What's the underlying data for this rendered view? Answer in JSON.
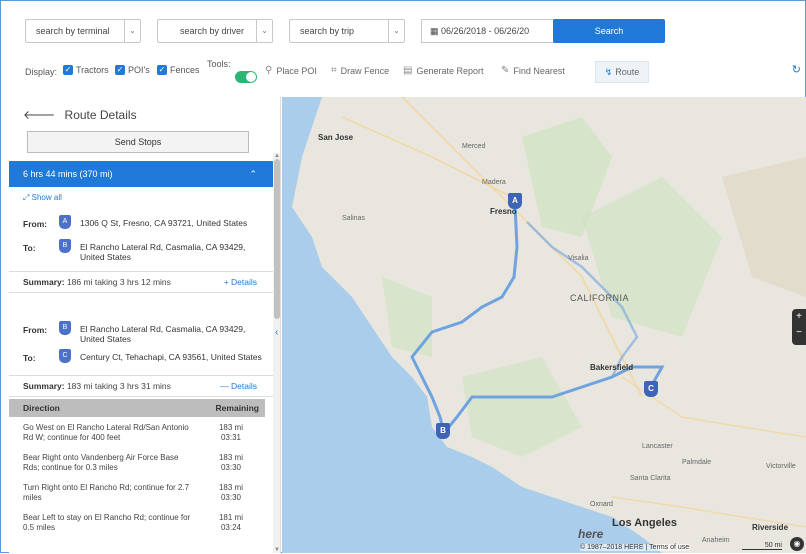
{
  "search": {
    "terminal": "search by terminal",
    "driver": "search by driver",
    "trip": "search by trip",
    "date_range": "06/26/2018 - 06/26/20",
    "button": "Search"
  },
  "display": {
    "label": "Display:",
    "checks": [
      "Tractors",
      "POI's",
      "Fences"
    ],
    "tools_label": "Tools:",
    "tools": [
      "Place POI",
      "Draw Fence",
      "Generate Report",
      "Find Nearest"
    ],
    "route": "Route"
  },
  "panel": {
    "title": "Route Details",
    "send_stops": "Send Stops",
    "route_summary": "6 hrs 44 mins (370 mi)",
    "show_all": "Show all",
    "legs": [
      {
        "from_label": "From:",
        "from_pin": "A",
        "from": "1306 Q St, Fresno, CA 93721, United States",
        "to_label": "To:",
        "to_pin": "B",
        "to": "El Rancho Lateral Rd, Casmalia, CA 93429, United States",
        "summary_label": "Summary:",
        "summary": "186 mi taking 3 hrs 12 mins",
        "details": "+ Details"
      },
      {
        "from_label": "From:",
        "from_pin": "B",
        "from": "El Rancho Lateral Rd, Casmalia, CA 93429, United States",
        "to_label": "To:",
        "to_pin": "C",
        "to": "Century Ct, Tehachapi, CA 93561, United States",
        "summary_label": "Summary:",
        "summary": "183 mi taking 3 hrs 31 mins",
        "details": "— Details"
      }
    ],
    "directions": {
      "col_direction": "Direction",
      "col_remaining": "Remaining",
      "rows": [
        {
          "text": "Go West on El Rancho Lateral Rd/San Antonio Rd W; continue for 400 feet",
          "miles": "183 mi",
          "time": "03:31"
        },
        {
          "text": "Bear Right onto Vandenberg Air Force Base Rds; continue for 0.3 miles",
          "miles": "183 mi",
          "time": "03:30"
        },
        {
          "text": "Turn Right onto El Rancho Rd; continue for 2.7 miles",
          "miles": "183 mi",
          "time": "03:30"
        },
        {
          "text": "Bear Left to stay on El Rancho Rd; continue for 0.5 miles",
          "miles": "181 mi",
          "time": "03:24"
        }
      ]
    }
  },
  "map": {
    "labels": {
      "san_jose": "San Jose",
      "salinas": "Salinas",
      "fresno": "Fresno",
      "visalia": "Visalia",
      "california": "CALIFORNIA",
      "bakersfield": "Bakersfield",
      "los_angeles": "Los Angeles",
      "santa_clarita": "Santa Clarita",
      "lancaster": "Lancaster",
      "palmdale": "Palmdale",
      "riverside": "Riverside",
      "victorville": "Victorville",
      "oxnard": "Oxnard",
      "merced": "Merced",
      "madera": "Madera",
      "anaheim": "Anaheim"
    },
    "pins": [
      "A",
      "B",
      "C"
    ],
    "copyright": "© 1987–2018 HERE | Terms of use",
    "scale": "50 mi",
    "colors": {
      "route": "#6fa3e0",
      "water": "#a9cdea",
      "land": "#ece9e0",
      "park": "#cfe3c0"
    }
  }
}
